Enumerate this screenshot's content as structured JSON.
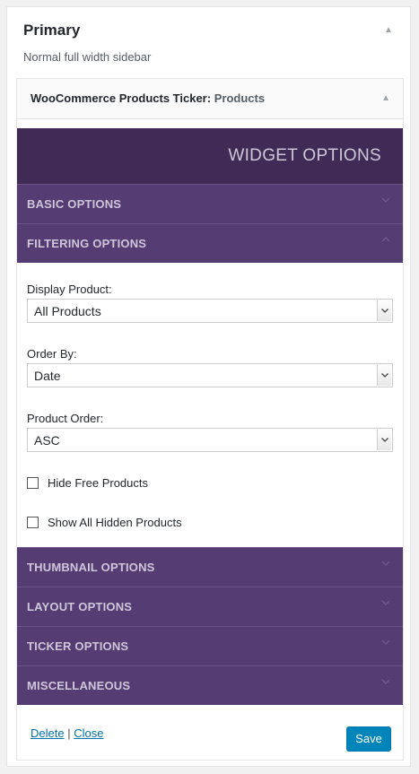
{
  "sidebar": {
    "title": "Primary",
    "description": "Normal full width sidebar"
  },
  "widget": {
    "title": "WooCommerce Products Ticker",
    "title_separator": ":",
    "instance_title": "Products",
    "options_header": "WIDGET OPTIONS",
    "sections_top": [
      {
        "label": "BASIC OPTIONS",
        "expanded": false
      },
      {
        "label": "FILTERING OPTIONS",
        "expanded": true
      }
    ],
    "filtering": {
      "display_product_label": "Display Product:",
      "display_product_value": "All Products",
      "order_by_label": "Order By:",
      "order_by_value": "Date",
      "product_order_label": "Product Order:",
      "product_order_value": "ASC",
      "hide_free_label": "Hide Free Products",
      "hide_free_checked": false,
      "show_hidden_label": "Show All Hidden Products",
      "show_hidden_checked": false
    },
    "sections_bottom": [
      {
        "label": "THUMBNAIL OPTIONS"
      },
      {
        "label": "LAYOUT OPTIONS"
      },
      {
        "label": "TICKER OPTIONS"
      },
      {
        "label": "MISCELLANEOUS"
      }
    ],
    "footer": {
      "delete_label": "Delete",
      "separator": "|",
      "close_label": "Close",
      "save_label": "Save"
    }
  },
  "colors": {
    "header_bg": "#3f2b55",
    "section_bg": "#553c73",
    "section_text": "#cfc6da",
    "link": "#0073aa",
    "save_button": "#0085ba"
  }
}
